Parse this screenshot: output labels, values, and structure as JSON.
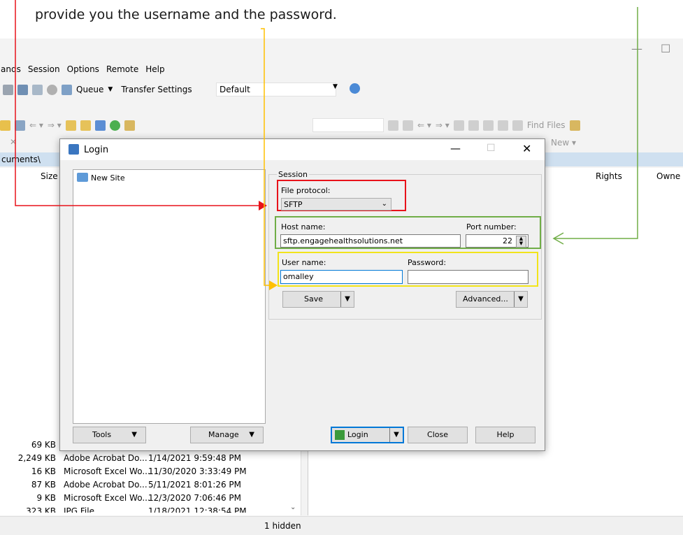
{
  "caption": "provide you the username and the password.",
  "menu": [
    "ands",
    "Session",
    "Options",
    "Remote",
    "Help"
  ],
  "toolbar": {
    "queue": "Queue",
    "transfer_settings": "Transfer Settings",
    "transfer_value": "Default",
    "find_files": "Find Files",
    "new_label": "New"
  },
  "path_fragment": "cuments\\",
  "left_columns": {
    "size": "Size"
  },
  "right_columns": {
    "rights": "Rights",
    "owner": "Owne"
  },
  "files": [
    {
      "size": "69 KB",
      "type": "",
      "date": ""
    },
    {
      "size": "2,249 KB",
      "type": "Adobe Acrobat Do...",
      "date": "1/14/2021 9:59:48 PM"
    },
    {
      "size": "16 KB",
      "type": "Microsoft Excel Wo...",
      "date": "11/30/2020 3:33:49 PM"
    },
    {
      "size": "87 KB",
      "type": "Adobe Acrobat Do...",
      "date": "5/11/2021 8:01:26 PM"
    },
    {
      "size": "9 KB",
      "type": "Microsoft Excel Wo...",
      "date": "12/3/2020 7:06:46 PM"
    },
    {
      "size": "323 KB",
      "type": "JPG File",
      "date": "1/18/2021 12:38:54 PM"
    }
  ],
  "status": "1 hidden",
  "dialog": {
    "title": "Login",
    "site": "New Site",
    "session_label": "Session",
    "protocol_label": "File protocol:",
    "protocol_value": "SFTP",
    "host_label": "Host name:",
    "host_value": "sftp.engagehealthsolutions.net",
    "port_label": "Port number:",
    "port_value": "22",
    "user_label": "User name:",
    "user_value": "omalley",
    "password_label": "Password:",
    "password_value": "",
    "save": "Save",
    "advanced": "Advanced...",
    "tools": "Tools",
    "manage": "Manage",
    "login": "Login",
    "close": "Close",
    "help": "Help"
  },
  "colors": {
    "red": "#e8121a",
    "yellow": "#f2e41a",
    "green": "#70ad47",
    "orange": "#ffc000",
    "pathbar": "#cfe0f0"
  }
}
